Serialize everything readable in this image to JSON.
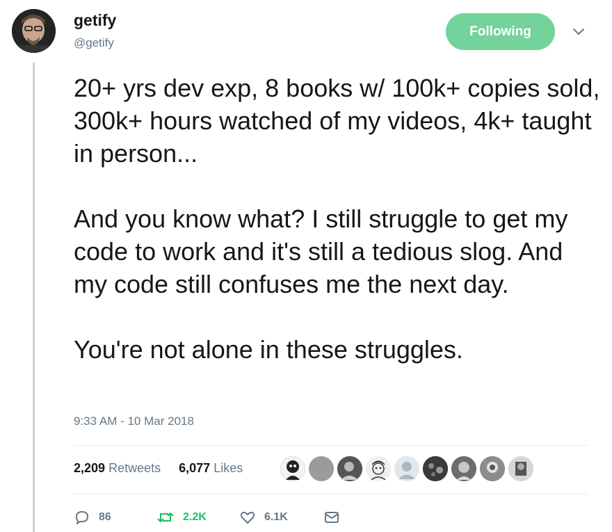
{
  "author": {
    "display_name": "getify",
    "handle": "@getify"
  },
  "follow_button": {
    "label": "Following",
    "color": "#73d39a"
  },
  "tweet": {
    "paragraphs": [
      "20+ yrs dev exp, 8 books w/ 100k+ copies sold, 300k+ hours watched of my videos, 4k+ taught in person...",
      "And you know what? I still struggle to get my code to work and it's still a tedious slog. And my code still confuses me the next day.",
      "You're not alone in these struggles."
    ],
    "timestamp": "9:33 AM - 10 Mar 2018"
  },
  "stats": {
    "retweets_count": "2,209",
    "retweets_label": "Retweets",
    "likes_count": "6,077",
    "likes_label": "Likes"
  },
  "actions": {
    "reply_count": "86",
    "retweet_count": "2.2K",
    "like_count": "6.1K"
  },
  "colors": {
    "muted": "#657786",
    "retweet_green": "#17bf63",
    "thread_line": "#c8d2d6"
  }
}
